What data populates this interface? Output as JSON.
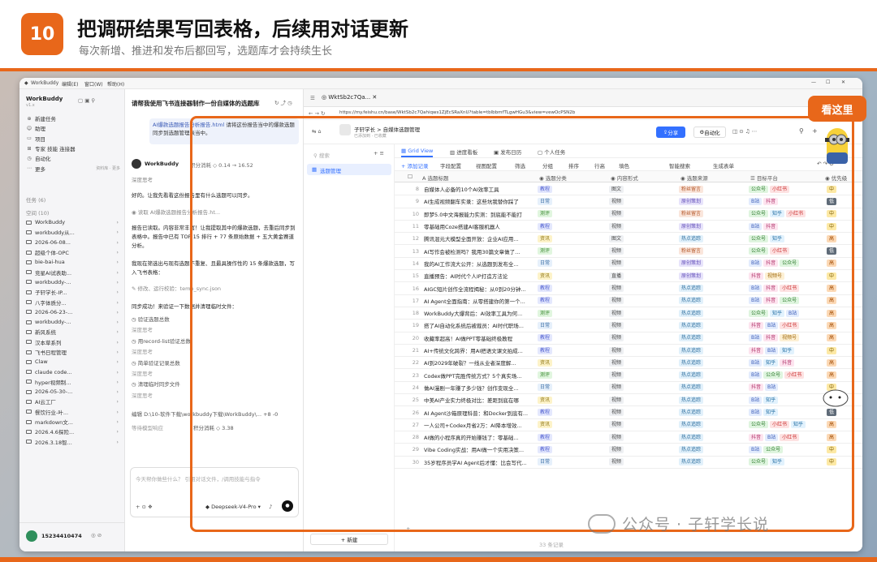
{
  "header": {
    "badge": "10",
    "title": "把调研结果写回表格，后续用对话更新",
    "subtitle": "每次新增、推进和发布后都回写，选题库才会持续生长"
  },
  "callout": "看这里",
  "watermark": "公众号 · 子轩学长说",
  "titlebar": {
    "app": "WorkBuddy",
    "menu": [
      "编辑(E)",
      "窗口(W)",
      "帮助(H)"
    ]
  },
  "sidebar": {
    "brand": "WorkBuddy",
    "version": "v1.x",
    "nav": [
      "新建任务",
      "助理",
      "项目",
      "专家 技能 连接器",
      "自动化",
      "更多"
    ],
    "nav_extra": "资料库 · 更多",
    "section_tasks": "任务 (6)",
    "section_space": "空间 (10)",
    "folders": [
      "WorkBuddy",
      "workbuddy从...",
      "2026-06-08...",
      "超级个体-OPC",
      "bie-bai-hua",
      "竞星AI试表助...",
      "workbuddy-...",
      "子轩学长-IP...",
      "八字体质分...",
      "2026-06-23-...",
      "workbuddy-...",
      "新风系统",
      "汉本草系列",
      "飞书日程管理",
      "Claw",
      "claude code...",
      "hyper视频制...",
      "2026-05-30-...",
      "AI云工厂",
      "餐饮行业-叶...",
      "markdown文...",
      "2026.4.6探险...",
      "2026.3.18智..."
    ],
    "user": "15234410474"
  },
  "chat": {
    "title": "请帮我使用飞书连接器制作一份自媒体的选题库",
    "attach_name": "AI爆款选题报告分析报告.html",
    "attach_text": "请将这份报告当中的爆款选题同步到选题管理表当中。",
    "bot": "WorkBuddy",
    "usage": "积分消耗 ◇ 0.14 → 16.52",
    "think1": "深度思考",
    "msg1": "好的。让我先看看这份报告里有什么选题可以同步。",
    "tool1": "读取 AI爆款选题报告分析报告.ht...",
    "msg2": "报告已读取。内容非常丰富！让我提取其中的爆款选题，去重后同步到表格中。报告中已有 TOP 15 排行 + 77 条原始数据 + 五大黄金赛道分析。",
    "msg3": "我现在筛选出与现有选题不重复、且最具操作性的 15 条爆款选题，写入飞书表格：",
    "tool2": "修改、运行校验：temp_sync.json",
    "msg4": "同步成功！来验证一下数据并清理临时文件：",
    "steps": [
      "验证选题总数",
      "深度思考",
      "用record-list验证总数",
      "深度思考",
      "简单验证记录总数",
      "深度思考",
      "清理临时同步文件",
      "深度思考"
    ],
    "path": "编辑 D:\\10-软件下载\\workbuddy下载\\WorkBuddy\\...  +8 -0",
    "footer_left": "等待模型响应",
    "footer_right": "积分消耗 ◇ 3.38",
    "input_placeholder": "今天帮你做些什么？  引用对话文件，/调用技能与指令",
    "model": "Deepseek-V4-Pro"
  },
  "browser": {
    "tab": "WktSb2c7Qa...",
    "url": "https://my.feishu.cn/base/WktSb2c7Qahiqws1ZjEcSRaXnU?table=tblbbmfTLgwHGu3&view=vewOcPSN2b",
    "breadcrumb": "子轩学长  >  自媒体选题管理",
    "breadcrumb_sub": "已添加到 · 已收藏",
    "share": "分享",
    "automation": "自动化",
    "search": "搜索",
    "table_name": "选题管理",
    "new": "+ 新建",
    "views": [
      "Grid View",
      "进度看板",
      "发布日历",
      "个人任务"
    ],
    "toolbar": [
      "+ 添加记录",
      "字段配置",
      "视图配置",
      "筛选",
      "分组",
      "排序",
      "行高",
      "填色",
      "智能搜索",
      "生成表单"
    ],
    "columns": [
      "选题标题",
      "选题分类",
      "内容形式",
      "选题来源",
      "目标平台",
      "优先级"
    ],
    "footer": "33 条记录"
  },
  "rows": [
    {
      "n": "8",
      "title": "自媒体人必备的10个AI效率工具",
      "cat": "教程",
      "form": "图文",
      "src": "粉丝留言",
      "plat": [
        "公众号",
        "小红书"
      ],
      "pri": "中"
    },
    {
      "n": "9",
      "title": "AI生成视频翻车实录：这些坑我替你踩了",
      "cat": "日常",
      "form": "视频",
      "src": "原创策划",
      "plat": [
        "B站",
        "抖音"
      ],
      "pri": "低"
    },
    {
      "n": "10",
      "title": "即梦5.0中文海报能力实测：到底能不能打",
      "cat": "测评",
      "form": "视频",
      "src": "粉丝留言",
      "plat": [
        "公众号",
        "知乎",
        "小红书"
      ],
      "pri": "中"
    },
    {
      "n": "11",
      "title": "零基础用Coze搭建AI客服机器人",
      "cat": "教程",
      "form": "视频",
      "src": "原创策划",
      "plat": [
        "B站",
        "抖音"
      ],
      "pri": "中"
    },
    {
      "n": "12",
      "title": "腾讯混元大模型全面开放：企业AI应用...",
      "cat": "资讯",
      "form": "图文",
      "src": "热点追踪",
      "plat": [
        "公众号",
        "知乎"
      ],
      "pri": "高"
    },
    {
      "n": "13",
      "title": "AI写作会被检测吗？我用30篇文章做了...",
      "cat": "测评",
      "form": "视频",
      "src": "粉丝留言",
      "plat": [
        "公众号",
        "小红书"
      ],
      "pri": "低"
    },
    {
      "n": "14",
      "title": "我的AI工作流大公开：从选题到发布全...",
      "cat": "日常",
      "form": "视频",
      "src": "原创策划",
      "plat": [
        "B站",
        "抖音",
        "公众号"
      ],
      "pri": "高"
    },
    {
      "n": "15",
      "title": "直播预告：AI时代个人IP打造方法论",
      "cat": "资讯",
      "form": "直播",
      "src": "原创策划",
      "plat": [
        "抖音",
        "视频号"
      ],
      "pri": "中"
    },
    {
      "n": "16",
      "title": "AIGC短片创作全流程揭秘：从0到20分钟...",
      "cat": "教程",
      "form": "视频",
      "src": "热点追踪",
      "plat": [
        "B站",
        "抖音",
        "小红书"
      ],
      "pri": "高"
    },
    {
      "n": "17",
      "title": "AI Agent全面指南：从零搭建你的第一个...",
      "cat": "教程",
      "form": "视频",
      "src": "热点追踪",
      "plat": [
        "B站",
        "抖音",
        "公众号"
      ],
      "pri": "高"
    },
    {
      "n": "18",
      "title": "WorkBuddy大爆背后：AI效率工具为何...",
      "cat": "测评",
      "form": "视频",
      "src": "热点追踪",
      "plat": [
        "公众号",
        "知乎",
        "B站"
      ],
      "pri": "高"
    },
    {
      "n": "19",
      "title": "搭了AI自动化系统后被裁员：AI时代职场...",
      "cat": "日常",
      "form": "视频",
      "src": "热点追踪",
      "plat": [
        "抖音",
        "B站",
        "小红书"
      ],
      "pri": "高"
    },
    {
      "n": "20",
      "title": "收藏率超高！AI做PPT零基础终极教程",
      "cat": "教程",
      "form": "视频",
      "src": "热点追踪",
      "plat": [
        "B站",
        "抖音",
        "视频号"
      ],
      "pri": "高"
    },
    {
      "n": "21",
      "title": "AI+传统文化跨界：用AI把语文课文拍成...",
      "cat": "教程",
      "form": "视频",
      "src": "热点追踪",
      "plat": [
        "抖音",
        "B站",
        "知乎"
      ],
      "pri": "中"
    },
    {
      "n": "22",
      "title": "AI到2029年破裂？一线从业者深度解...",
      "cat": "资讯",
      "form": "视频",
      "src": "热点追踪",
      "plat": [
        "B站",
        "知乎",
        "抖音"
      ],
      "pri": "高"
    },
    {
      "n": "23",
      "title": "Codex做PPT完胜传统方式？5个真实场...",
      "cat": "测评",
      "form": "视频",
      "src": "热点追踪",
      "plat": [
        "B站",
        "公众号",
        "小红书"
      ],
      "pri": "高"
    },
    {
      "n": "24",
      "title": "做AI漫剧一年赚了多少钱？创作变现全...",
      "cat": "日常",
      "form": "视频",
      "src": "热点追踪",
      "plat": [
        "抖音",
        "B站"
      ],
      "pri": "中"
    },
    {
      "n": "25",
      "title": "中美AI产业实力终极对比：差距到底在哪",
      "cat": "资讯",
      "form": "视频",
      "src": "热点追踪",
      "plat": [
        "B站",
        "知乎"
      ],
      "pri": "中"
    },
    {
      "n": "26",
      "title": "AI Agent沙箱原理科普：和Docker到底有...",
      "cat": "教程",
      "form": "视频",
      "src": "热点追踪",
      "plat": [
        "B站",
        "知乎"
      ],
      "pri": "低"
    },
    {
      "n": "27",
      "title": "一人公司+Codex月省2万：AI降本增效...",
      "cat": "资讯",
      "form": "视频",
      "src": "热点追踪",
      "plat": [
        "公众号",
        "小红书",
        "知乎"
      ],
      "pri": "高"
    },
    {
      "n": "28",
      "title": "AI做的小程序真的开始赚钱了：零基础...",
      "cat": "教程",
      "form": "视频",
      "src": "热点追踪",
      "plat": [
        "抖音",
        "B站",
        "小红书"
      ],
      "pri": "高"
    },
    {
      "n": "29",
      "title": "Vibe Coding实战：用AI做一个实用决策...",
      "cat": "教程",
      "form": "视频",
      "src": "热点追踪",
      "plat": [
        "B站",
        "公众号"
      ],
      "pri": "中"
    },
    {
      "n": "30",
      "title": "35岁程序员学AI Agent后才懂：比会写代...",
      "cat": "日常",
      "form": "视频",
      "src": "热点追踪",
      "plat": [
        "公众号",
        "知乎"
      ],
      "pri": "中"
    }
  ]
}
